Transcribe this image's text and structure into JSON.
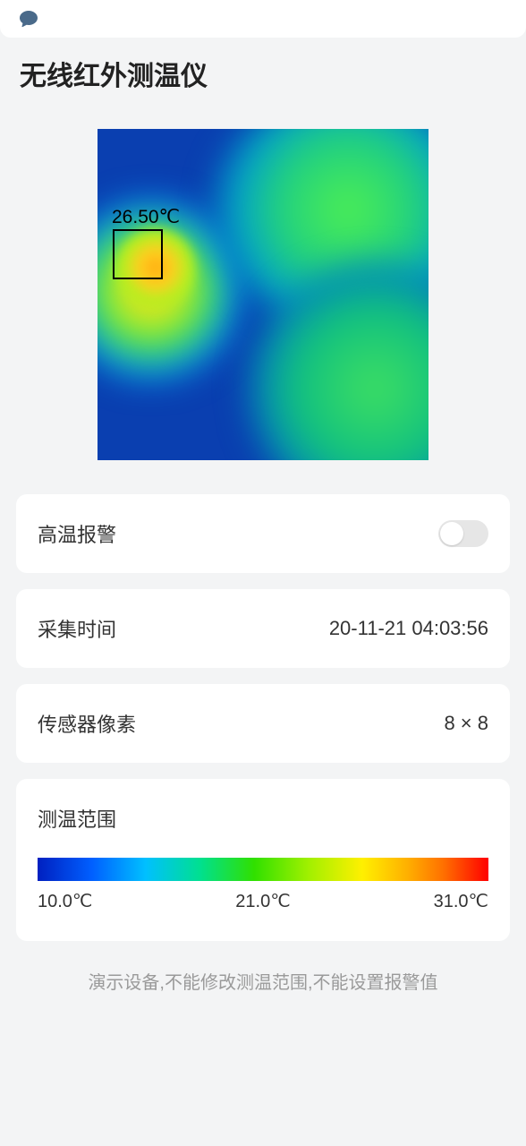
{
  "title": "无线红外测温仪",
  "thermal": {
    "hotspot_label": "26.50℃"
  },
  "cards": {
    "alarm_label": "高温报警",
    "collect_time_label": "采集时间",
    "collect_time_value": "20-11-21 04:03:56",
    "sensor_pixel_label": "传感器像素",
    "sensor_pixel_value": "8 × 8",
    "range_label": "测温范围"
  },
  "range": {
    "min": "10.0℃",
    "mid": "21.0℃",
    "max": "31.0℃"
  },
  "footer": "演示设备,不能修改测温范围,不能设置报警值"
}
